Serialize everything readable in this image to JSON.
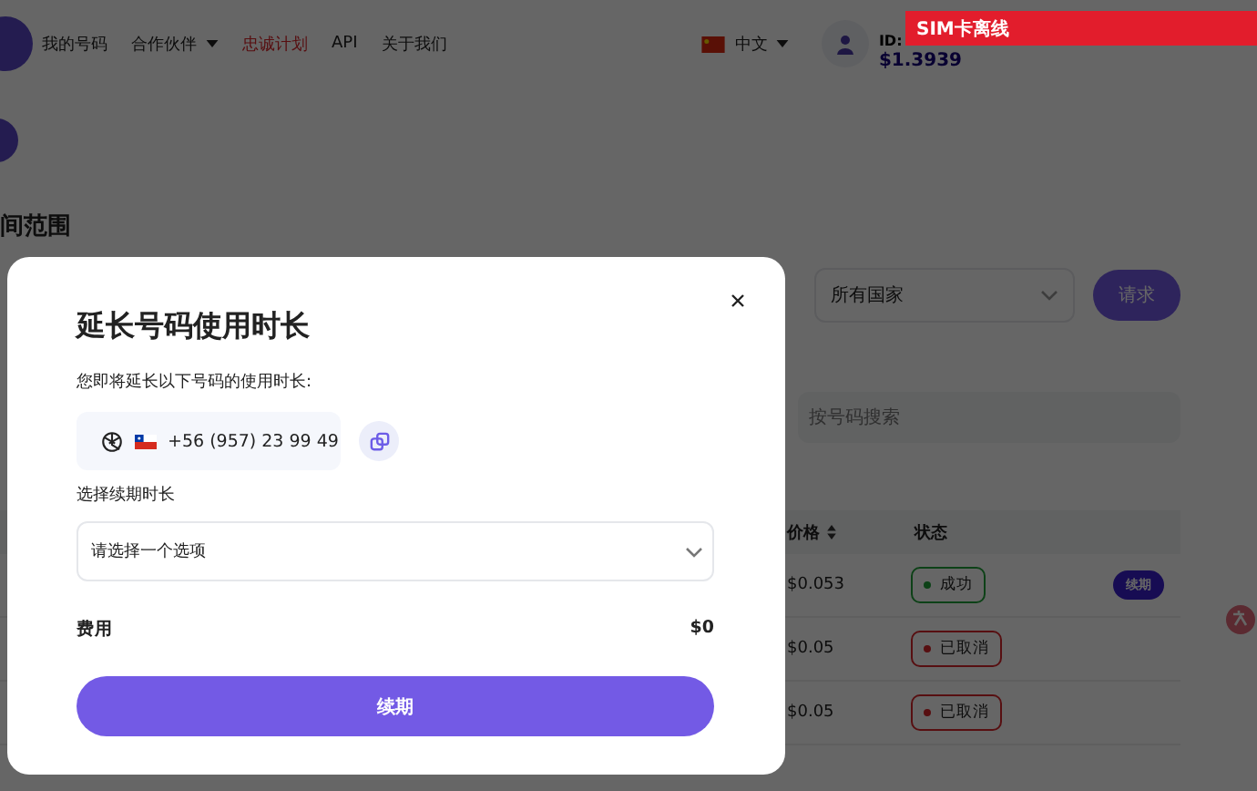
{
  "nav": {
    "items": [
      {
        "label": "我的号码",
        "highlighted": false,
        "dropdown": false
      },
      {
        "label": "合作伙伴",
        "highlighted": false,
        "dropdown": true
      },
      {
        "label": "忠诚计划",
        "highlighted": true,
        "dropdown": false
      },
      {
        "label": "API",
        "highlighted": false,
        "dropdown": false
      },
      {
        "label": "关于我们",
        "highlighted": false,
        "dropdown": false
      }
    ]
  },
  "language": "中文",
  "account": {
    "id": "ID:",
    "balance": "$1.3939"
  },
  "section_title": "间范围",
  "filters": {
    "country": "所有国家",
    "request_button": "请求"
  },
  "search": {
    "placeholder": "按号码搜索"
  },
  "table": {
    "columns": [
      "价格",
      "状态"
    ],
    "rows": [
      {
        "price": "$0.053",
        "status": "成功",
        "kind": "success",
        "action": "续期"
      },
      {
        "price": "$0.05",
        "status": "已取消",
        "kind": "cancelled"
      },
      {
        "price": "$0.05",
        "status": "已取消",
        "kind": "cancelled"
      }
    ]
  },
  "modal": {
    "title": "延长号码使用时长",
    "intro": "您即将延长以下号码的使用时长:",
    "number": "+56 (957) 23 99 49",
    "duration_label": "选择续期时长",
    "duration_placeholder": "请选择一个选项",
    "cost_label": "费用",
    "cost": "$0",
    "submit": "续期"
  },
  "toast": "SIM卡离线"
}
